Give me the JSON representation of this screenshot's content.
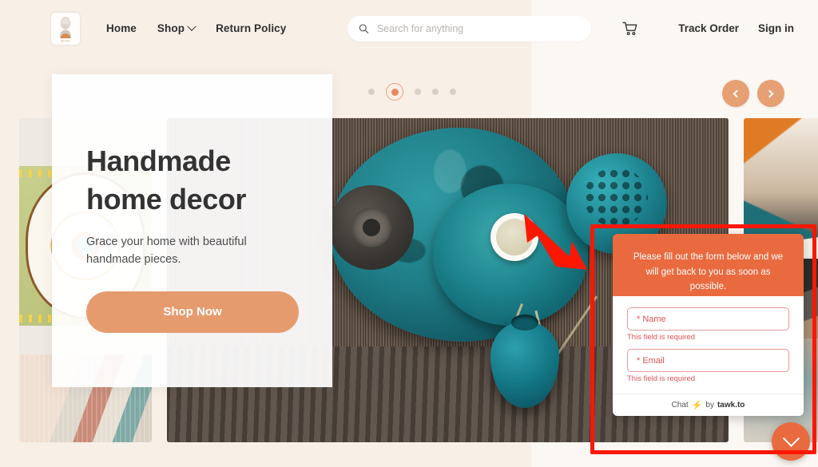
{
  "site": {
    "background_left": "#f8efe7",
    "background_right": "#fbf7f2",
    "accent": "#e69b6f",
    "chat_accent": "#ea6a3f",
    "annotation_color": "#fc1703"
  },
  "header": {
    "logo": {
      "name": "brand-logo",
      "caption": "the artist"
    },
    "nav": [
      {
        "label": "Home",
        "has_caret": false
      },
      {
        "label": "Shop",
        "has_caret": true
      },
      {
        "label": "Return Policy",
        "has_caret": false
      }
    ],
    "search": {
      "placeholder": "Search for anything",
      "value": "",
      "icon": "search-icon"
    },
    "cart": {
      "icon": "shopping-cart-icon"
    },
    "track_order": "Track Order",
    "sign_in": "Sign in"
  },
  "carousel": {
    "dots": [
      {
        "active": false
      },
      {
        "active": true
      },
      {
        "active": false
      },
      {
        "active": false
      },
      {
        "active": false
      }
    ],
    "dot_count": 5,
    "active_index": 1,
    "prev_label": "‹",
    "next_label": "›"
  },
  "hero": {
    "title_line1": "Handmade",
    "title_line2": "home decor",
    "subtitle_line1": "Grace your home with beautiful",
    "subtitle_line2": "handmade pieces.",
    "cta_label": "Shop Now"
  },
  "chat": {
    "header_text": "Please fill out the form below and we will get back to you as soon as possible.",
    "fields": [
      {
        "placeholder": "* Name",
        "value": "",
        "error": "This field is required"
      },
      {
        "placeholder": "* Email",
        "value": "",
        "error": "This field is required"
      }
    ],
    "footer": {
      "prefix": "Chat",
      "bolt": "⚡",
      "by": "by",
      "brand": "tawk.to"
    },
    "minimize_icon": "chevron-down-icon"
  }
}
